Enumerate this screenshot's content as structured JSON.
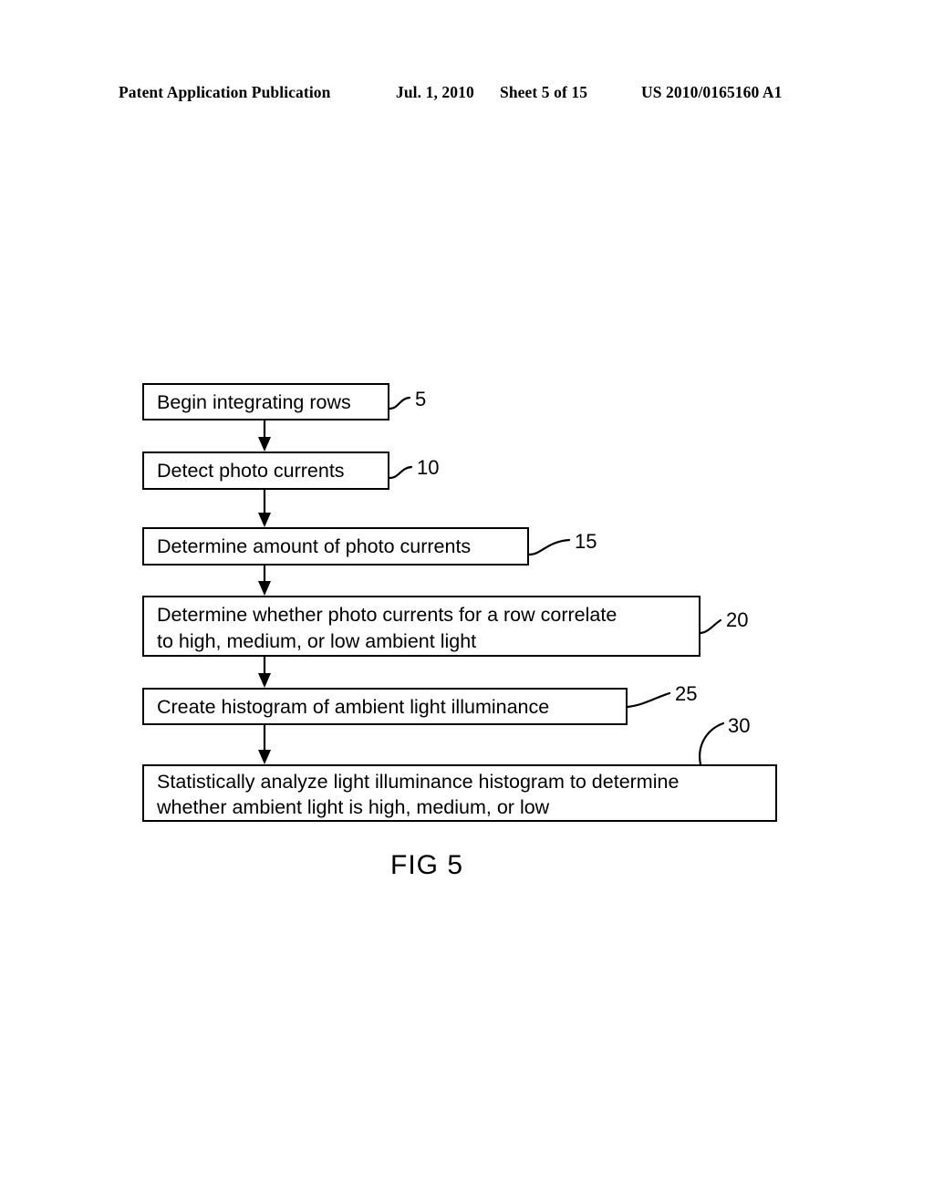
{
  "header": {
    "publication": "Patent Application Publication",
    "date": "Jul. 1, 2010",
    "sheet": "Sheet 5 of 15",
    "patent_number": "US 2010/0165160 A1"
  },
  "figure": {
    "caption": "FIG 5",
    "type": "flowchart",
    "steps": [
      {
        "ref": "5",
        "lines": [
          "Begin integrating rows"
        ],
        "line1": "Begin integrating rows",
        "line2": ""
      },
      {
        "ref": "10",
        "lines": [
          "Detect photo currents"
        ],
        "line1": "Detect photo currents",
        "line2": ""
      },
      {
        "ref": "15",
        "lines": [
          "Determine amount of photo currents"
        ],
        "line1": "Determine amount of photo currents",
        "line2": ""
      },
      {
        "ref": "20",
        "lines": [
          "Determine whether photo currents for a row correlate",
          "to high, medium, or low ambient light"
        ],
        "line1": "Determine whether photo currents for a row correlate",
        "line2": "to high, medium, or low ambient light"
      },
      {
        "ref": "25",
        "lines": [
          "Create histogram of ambient light illuminance"
        ],
        "line1": "Create histogram of ambient light illuminance",
        "line2": ""
      },
      {
        "ref": "30",
        "lines": [
          "Statistically analyze light illuminance histogram to determine",
          "whether ambient light is high, medium, or low"
        ],
        "line1": "Statistically analyze light illuminance histogram to determine",
        "line2": "whether ambient light is high, medium, or low"
      }
    ]
  },
  "colors": {
    "ink": "#000000",
    "page": "#ffffff"
  }
}
